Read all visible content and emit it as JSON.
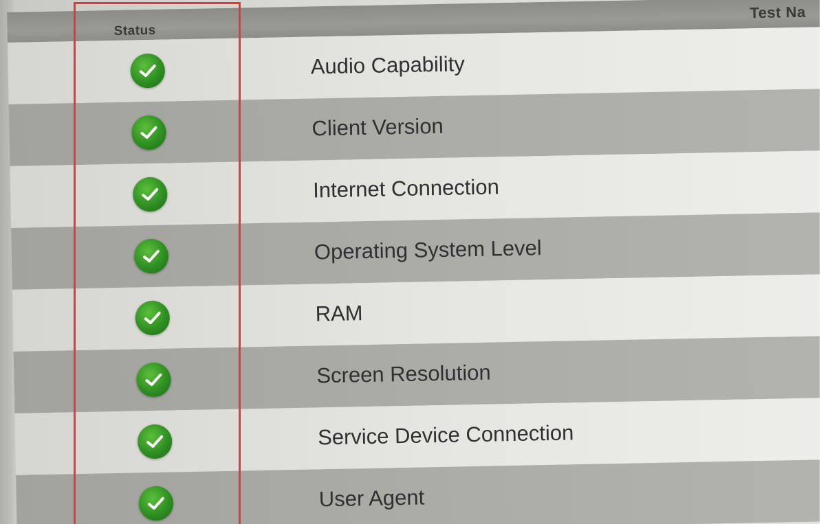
{
  "table": {
    "headers": {
      "status": "Status",
      "test_name": "Test Na"
    },
    "rows": [
      {
        "status": "pass",
        "status_icon": "check-circle-icon",
        "name": "Audio Capability"
      },
      {
        "status": "pass",
        "status_icon": "check-circle-icon",
        "name": "Client Version"
      },
      {
        "status": "pass",
        "status_icon": "check-circle-icon",
        "name": "Internet Connection"
      },
      {
        "status": "pass",
        "status_icon": "check-circle-icon",
        "name": "Operating System Level"
      },
      {
        "status": "pass",
        "status_icon": "check-circle-icon",
        "name": "RAM"
      },
      {
        "status": "pass",
        "status_icon": "check-circle-icon",
        "name": "Screen Resolution"
      },
      {
        "status": "pass",
        "status_icon": "check-circle-icon",
        "name": "Service Device Connection"
      },
      {
        "status": "pass",
        "status_icon": "check-circle-icon",
        "name": "User Agent"
      }
    ]
  },
  "colors": {
    "pass_green": "#2e8f22",
    "highlight_red": "#e53935",
    "header_gray": "#9a9a94",
    "row_dark": "#acaca7",
    "row_light": "#e6e6e1"
  }
}
